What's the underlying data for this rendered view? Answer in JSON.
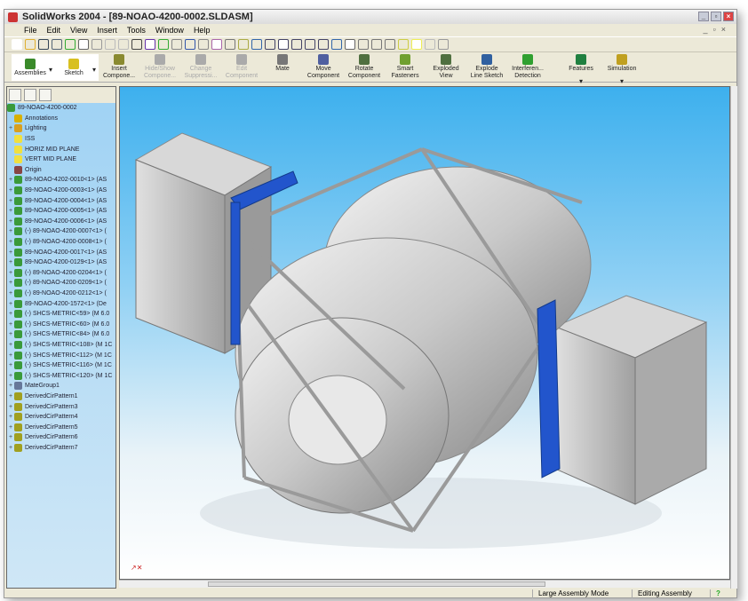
{
  "window": {
    "title": "SolidWorks 2004 - [89-NOAO-4200-0002.SLDASM]"
  },
  "menu": [
    "File",
    "Edit",
    "View",
    "Insert",
    "Tools",
    "Window",
    "Help"
  ],
  "command_manager": [
    {
      "label": "Assemblies",
      "enabled": true,
      "color": "#3a8a2a"
    },
    {
      "label": "Sketch",
      "enabled": true,
      "color": "#d8c020"
    },
    {
      "label": "Insert Compone...",
      "enabled": true,
      "color": "#8a8a30"
    },
    {
      "label": "Hide/Show Compone...",
      "enabled": false,
      "color": "#aaaaaa"
    },
    {
      "label": "Change Suppressi...",
      "enabled": false,
      "color": "#aaaaaa"
    },
    {
      "label": "Edit Component",
      "enabled": false,
      "color": "#aaaaaa"
    },
    {
      "label": "Mate",
      "enabled": true,
      "color": "#777777"
    },
    {
      "label": "Move Component",
      "enabled": true,
      "color": "#5060a0"
    },
    {
      "label": "Rotate Component",
      "enabled": true,
      "color": "#507040"
    },
    {
      "label": "Smart Fasteners",
      "enabled": true,
      "color": "#70a030"
    },
    {
      "label": "Exploded View",
      "enabled": true,
      "color": "#507040"
    },
    {
      "label": "Explode Line Sketch",
      "enabled": true,
      "color": "#3060a0"
    },
    {
      "label": "Interferen... Detection",
      "enabled": true,
      "color": "#30a030"
    },
    {
      "label": "Features",
      "enabled": true,
      "color": "#208040"
    },
    {
      "label": "Simulation",
      "enabled": true,
      "color": "#c0a020"
    }
  ],
  "tree": {
    "root": "89-NOAO-4200-0002",
    "items": [
      {
        "label": "Annotations",
        "expand": false,
        "icon": "annotations-icon",
        "color": "#d8b000"
      },
      {
        "label": "Lighting",
        "expand": true,
        "icon": "lighting-icon",
        "color": "#d8a020"
      },
      {
        "label": "ISS",
        "expand": false,
        "icon": "plane-icon",
        "color": "#f0e040"
      },
      {
        "label": "HORIZ MID PLANE",
        "expand": false,
        "icon": "plane-icon",
        "color": "#f0e040"
      },
      {
        "label": "VERT MID PLANE",
        "expand": false,
        "icon": "plane-icon",
        "color": "#f0e040"
      },
      {
        "label": "Origin",
        "expand": false,
        "icon": "origin-icon",
        "color": "#884444"
      },
      {
        "label": "89-NOAO-4202-0010<1> (AS",
        "expand": true,
        "icon": "assembly-icon",
        "color": "#3a9a3a"
      },
      {
        "label": "89-NOAO-4200-0003<1> (AS",
        "expand": true,
        "icon": "assembly-icon",
        "color": "#3a9a3a"
      },
      {
        "label": "89-NOAO-4200-0004<1> (AS",
        "expand": true,
        "icon": "assembly-icon",
        "color": "#3a9a3a"
      },
      {
        "label": "89-NOAO-4200-0005<1> (AS",
        "expand": true,
        "icon": "assembly-icon",
        "color": "#3a9a3a"
      },
      {
        "label": "89-NOAO-4200-0006<1> (AS",
        "expand": true,
        "icon": "assembly-icon",
        "color": "#3a9a3a"
      },
      {
        "label": "(-) 89-NOAO-4200-0007<1> (",
        "expand": true,
        "icon": "assembly-icon",
        "color": "#3a9a3a"
      },
      {
        "label": "(-) 89-NOAO-4200-0008<1> (",
        "expand": true,
        "icon": "assembly-icon",
        "color": "#3a9a3a"
      },
      {
        "label": "89-NOAO-4200-0017<1> (AS",
        "expand": true,
        "icon": "assembly-icon",
        "color": "#3a9a3a"
      },
      {
        "label": "89-NOAO-4200-0129<1> (AS",
        "expand": true,
        "icon": "assembly-icon",
        "color": "#3a9a3a"
      },
      {
        "label": "(-) 89-NOAO-4200-0204<1> (",
        "expand": true,
        "icon": "assembly-icon",
        "color": "#3a9a3a"
      },
      {
        "label": "(-) 89-NOAO-4200-0209<1> (",
        "expand": true,
        "icon": "assembly-icon",
        "color": "#3a9a3a"
      },
      {
        "label": "(-) 89-NOAO-4200-0212<1> (",
        "expand": true,
        "icon": "assembly-icon",
        "color": "#3a9a3a"
      },
      {
        "label": "89-NOAO-4200-1572<1> (De",
        "expand": true,
        "icon": "assembly-icon",
        "color": "#3a9a3a"
      },
      {
        "label": "(-) SHCS-METRIC<59> (M 6.0",
        "expand": true,
        "icon": "part-icon",
        "color": "#3a9a3a"
      },
      {
        "label": "(-) SHCS-METRIC<60> (M 6.0",
        "expand": true,
        "icon": "part-icon",
        "color": "#3a9a3a"
      },
      {
        "label": "(-) SHCS-METRIC<84> (M 6.0",
        "expand": true,
        "icon": "part-icon",
        "color": "#3a9a3a"
      },
      {
        "label": "(-) SHCS-METRIC<108> (M 1C",
        "expand": true,
        "icon": "part-icon",
        "color": "#3a9a3a"
      },
      {
        "label": "(-) SHCS-METRIC<112> (M 1C",
        "expand": true,
        "icon": "part-icon",
        "color": "#3a9a3a"
      },
      {
        "label": "(-) SHCS-METRIC<116> (M 1C",
        "expand": true,
        "icon": "part-icon",
        "color": "#3a9a3a"
      },
      {
        "label": "(-) SHCS-METRIC<120> (M 1C",
        "expand": true,
        "icon": "part-icon",
        "color": "#3a9a3a"
      },
      {
        "label": "MateGroup1",
        "expand": true,
        "icon": "mates-icon",
        "color": "#667799"
      },
      {
        "label": "DerivedCirPattern1",
        "expand": true,
        "icon": "pattern-icon",
        "color": "#a0a020"
      },
      {
        "label": "DerivedCirPattern3",
        "expand": true,
        "icon": "pattern-icon",
        "color": "#a0a020"
      },
      {
        "label": "DerivedCirPattern4",
        "expand": true,
        "icon": "pattern-icon",
        "color": "#a0a020"
      },
      {
        "label": "DerivedCirPattern5",
        "expand": true,
        "icon": "pattern-icon",
        "color": "#a0a020"
      },
      {
        "label": "DerivedCirPattern6",
        "expand": true,
        "icon": "pattern-icon",
        "color": "#a0a020"
      },
      {
        "label": "DerivedCirPattern7",
        "expand": true,
        "icon": "pattern-icon",
        "color": "#a0a020"
      }
    ]
  },
  "status": {
    "mode": "Large Assembly Mode",
    "state": "Editing Assembly",
    "help": "?"
  }
}
